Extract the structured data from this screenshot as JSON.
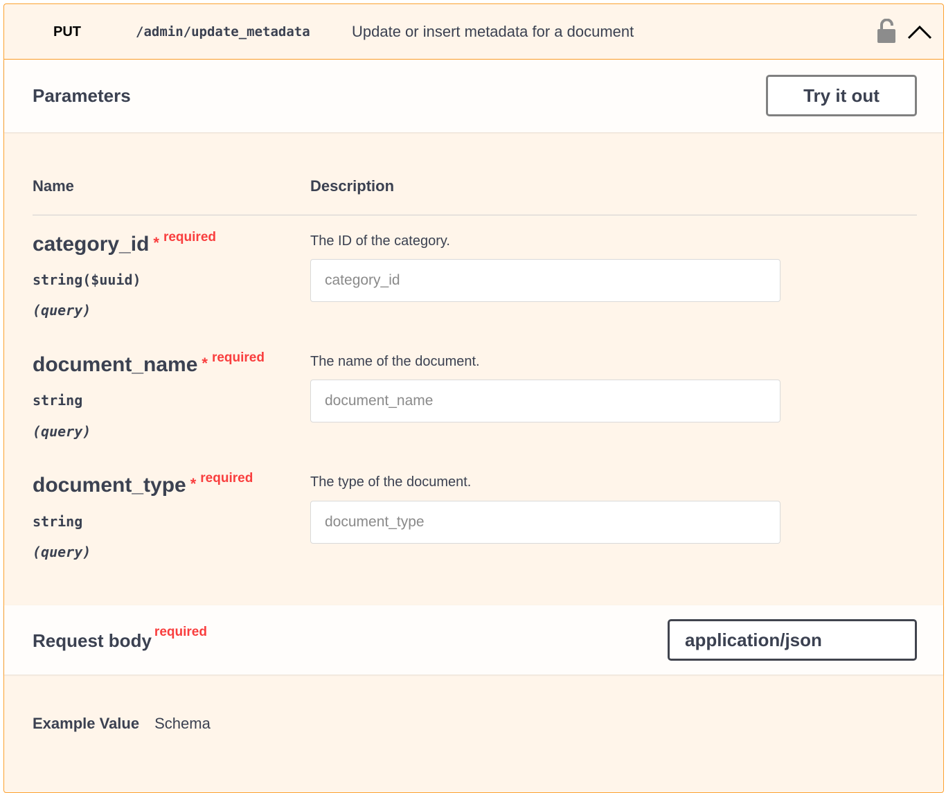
{
  "operation": {
    "method": "PUT",
    "path": "/admin/update_metadata",
    "summary": "Update or insert metadata for a document",
    "method_color": "#fca130"
  },
  "parameters_section": {
    "title": "Parameters",
    "try_it_out_label": "Try it out",
    "col_name": "Name",
    "col_description": "Description",
    "required_star": "*",
    "required_label": "required",
    "params": [
      {
        "name": "category_id",
        "type": "string($uuid)",
        "in": "(query)",
        "description": "The ID of the category.",
        "placeholder": "category_id"
      },
      {
        "name": "document_name",
        "type": "string",
        "in": "(query)",
        "description": "The name of the document.",
        "placeholder": "document_name"
      },
      {
        "name": "document_type",
        "type": "string",
        "in": "(query)",
        "description": "The type of the document.",
        "placeholder": "document_type"
      }
    ]
  },
  "request_body": {
    "title": "Request body",
    "required_label": "required",
    "content_type": "application/json",
    "tabs": [
      "Example Value",
      "Schema"
    ]
  },
  "icons": {
    "lock": "unlocked-padlock-icon",
    "collapse": "chevron-up-icon"
  },
  "colors": {
    "accent": "#fca130",
    "required": "#f93e3e",
    "text": "#3b4151"
  }
}
